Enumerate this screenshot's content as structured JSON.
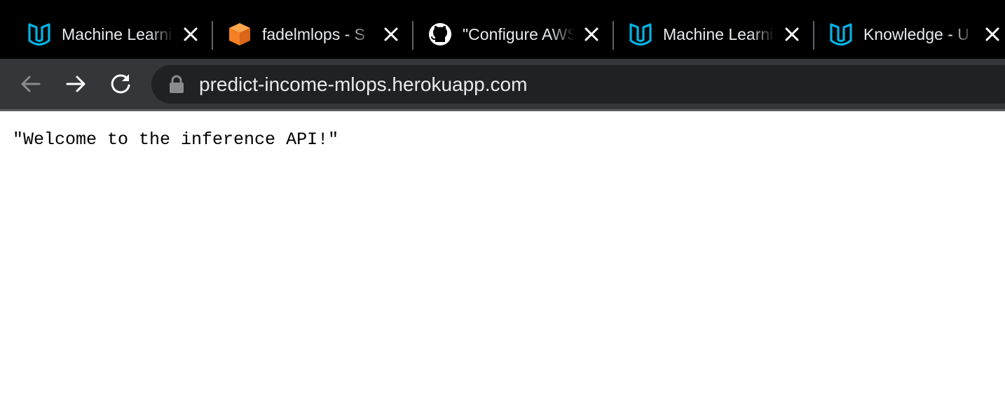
{
  "browser": {
    "tabs": [
      {
        "title": "Machine Learning",
        "icon": "udacity-logo-icon"
      },
      {
        "title": "fadelmlops - S",
        "icon": "orange-cube-icon"
      },
      {
        "title": "\"Configure AWS",
        "icon": "github-icon"
      },
      {
        "title": "Machine Learning",
        "icon": "udacity-logo-icon"
      },
      {
        "title": "Knowledge - U",
        "icon": "udacity-logo-icon"
      }
    ],
    "close_icon": "close-icon",
    "nav": {
      "back_icon": "back-arrow-icon",
      "forward_icon": "forward-arrow-icon",
      "reload_icon": "reload-icon"
    },
    "address_bar": {
      "url": "predict-income-mlops.herokuapp.com",
      "security_icon": "lock-icon"
    }
  },
  "page": {
    "body_text": "\"Welcome to the inference API!\""
  },
  "colors": {
    "tab_strip": "#000000",
    "toolbar": "#35363a",
    "omnibox": "#202124",
    "tab_text": "#e8eaed",
    "udacity_blue": "#02b3e4",
    "cube_orange": "#f58025",
    "disabled_icon": "#8a8b8e",
    "page_background": "#ffffff"
  }
}
